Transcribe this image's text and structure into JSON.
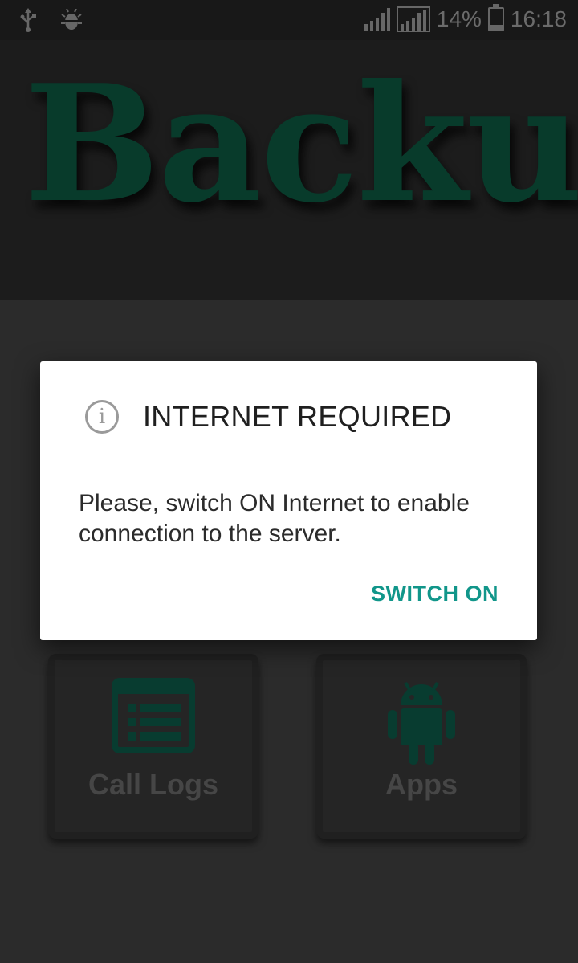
{
  "status_bar": {
    "battery_percent": "14%",
    "time": "16:18",
    "left_icons": [
      "usb-icon",
      "debug-bug-icon"
    ],
    "right_icons": [
      "signal-icon",
      "signal-boxed-icon",
      "battery-charging-icon"
    ]
  },
  "header": {
    "title": "Backup",
    "title_color": "#0b4f3a"
  },
  "tiles": [
    {
      "label": "Call Logs",
      "icon": "call-log-list-icon"
    },
    {
      "label": "Apps",
      "icon": "android-icon"
    }
  ],
  "dialog": {
    "icon": "info-icon",
    "title": "INTERNET REQUIRED",
    "message": "Please, switch ON Internet to enable connection to the server.",
    "button_label": "SWITCH ON",
    "accent_color": "#11968a"
  }
}
